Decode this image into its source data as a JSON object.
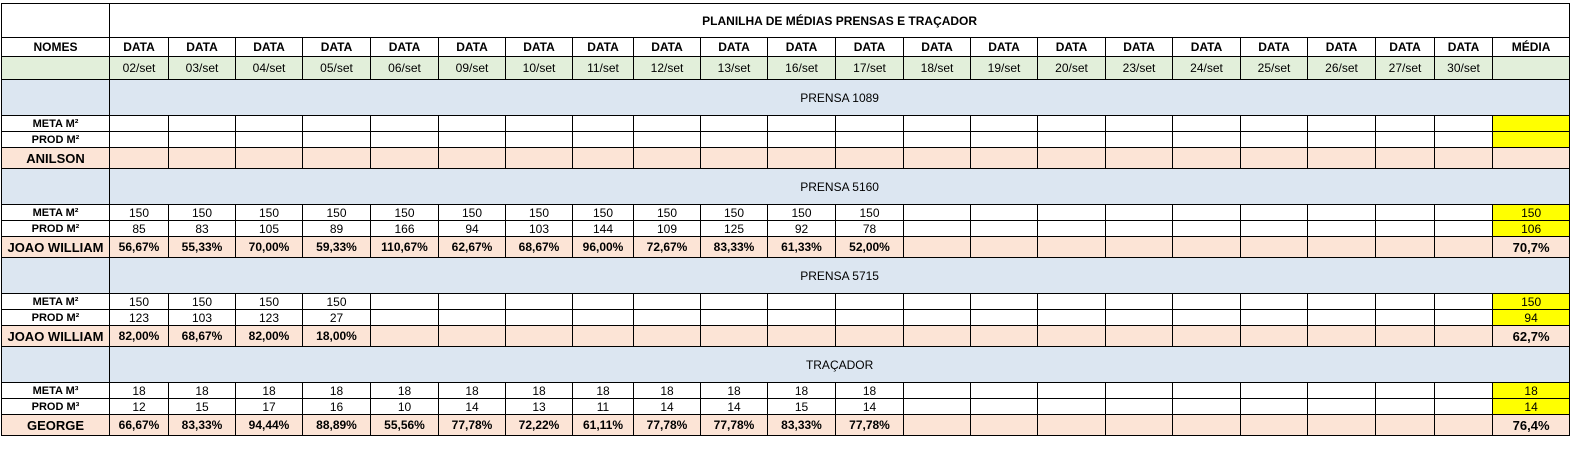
{
  "title": "PLANILHA DE MÉDIAS PRENSAS E TRAÇADOR",
  "header": {
    "names_label": "NOMES",
    "data_label": "DATA",
    "avg_label": "MÉDIA"
  },
  "dates": [
    "02/set",
    "03/set",
    "04/set",
    "05/set",
    "06/set",
    "09/set",
    "10/set",
    "11/set",
    "12/set",
    "13/set",
    "16/set",
    "17/set",
    "18/set",
    "19/set",
    "20/set",
    "23/set",
    "24/set",
    "25/set",
    "26/set",
    "27/set",
    "30/set"
  ],
  "sections": [
    {
      "title": "PRENSA 1089",
      "rows": [
        {
          "label": "META M²",
          "type": "meta",
          "values": [
            "",
            "",
            "",
            "",
            "",
            "",
            "",
            "",
            "",
            "",
            "",
            "",
            "",
            "",
            "",
            "",
            "",
            "",
            "",
            "",
            ""
          ],
          "avg": ""
        },
        {
          "label": "PROD M²",
          "type": "prod",
          "values": [
            "",
            "",
            "",
            "",
            "",
            "",
            "",
            "",
            "",
            "",
            "",
            "",
            "",
            "",
            "",
            "",
            "",
            "",
            "",
            "",
            ""
          ],
          "avg": ""
        },
        {
          "label": "ANILSON",
          "type": "pct",
          "values": [
            "",
            "",
            "",
            "",
            "",
            "",
            "",
            "",
            "",
            "",
            "",
            "",
            "",
            "",
            "",
            "",
            "",
            "",
            "",
            "",
            ""
          ],
          "avg": ""
        }
      ]
    },
    {
      "title": "PRENSA 5160",
      "rows": [
        {
          "label": "META M²",
          "type": "meta",
          "values": [
            "150",
            "150",
            "150",
            "150",
            "150",
            "150",
            "150",
            "150",
            "150",
            "150",
            "150",
            "150",
            "",
            "",
            "",
            "",
            "",
            "",
            "",
            "",
            ""
          ],
          "avg": "150"
        },
        {
          "label": "PROD M²",
          "type": "prod",
          "values": [
            "85",
            "83",
            "105",
            "89",
            "166",
            "94",
            "103",
            "144",
            "109",
            "125",
            "92",
            "78",
            "",
            "",
            "",
            "",
            "",
            "",
            "",
            "",
            ""
          ],
          "avg": "106"
        },
        {
          "label": "JOAO WILLIAM",
          "type": "pct",
          "values": [
            "56,67%",
            "55,33%",
            "70,00%",
            "59,33%",
            "110,67%",
            "62,67%",
            "68,67%",
            "96,00%",
            "72,67%",
            "83,33%",
            "61,33%",
            "52,00%",
            "",
            "",
            "",
            "",
            "",
            "",
            "",
            "",
            ""
          ],
          "avg": "70,7%"
        }
      ]
    },
    {
      "title": "PRENSA 5715",
      "rows": [
        {
          "label": "META M²",
          "type": "meta",
          "values": [
            "150",
            "150",
            "150",
            "150",
            "",
            "",
            "",
            "",
            "",
            "",
            "",
            "",
            "",
            "",
            "",
            "",
            "",
            "",
            "",
            "",
            ""
          ],
          "avg": "150"
        },
        {
          "label": "PROD M²",
          "type": "prod",
          "values": [
            "123",
            "103",
            "123",
            "27",
            "",
            "",
            "",
            "",
            "",
            "",
            "",
            "",
            "",
            "",
            "",
            "",
            "",
            "",
            "",
            "",
            ""
          ],
          "avg": "94"
        },
        {
          "label": "JOAO WILLIAM",
          "type": "pct",
          "values": [
            "82,00%",
            "68,67%",
            "82,00%",
            "18,00%",
            "",
            "",
            "",
            "",
            "",
            "",
            "",
            "",
            "",
            "",
            "",
            "",
            "",
            "",
            "",
            "",
            ""
          ],
          "avg": "62,7%"
        }
      ]
    },
    {
      "title": "TRAÇADOR",
      "rows": [
        {
          "label": "META M³",
          "type": "meta",
          "values": [
            "18",
            "18",
            "18",
            "18",
            "18",
            "18",
            "18",
            "18",
            "18",
            "18",
            "18",
            "18",
            "",
            "",
            "",
            "",
            "",
            "",
            "",
            "",
            ""
          ],
          "avg": "18"
        },
        {
          "label": "PROD M³",
          "type": "prod",
          "values": [
            "12",
            "15",
            "17",
            "16",
            "10",
            "14",
            "13",
            "11",
            "14",
            "14",
            "15",
            "14",
            "",
            "",
            "",
            "",
            "",
            "",
            "",
            "",
            ""
          ],
          "avg": "14"
        },
        {
          "label": "GEORGE",
          "type": "pct",
          "values": [
            "66,67%",
            "83,33%",
            "94,44%",
            "88,89%",
            "55,56%",
            "77,78%",
            "72,22%",
            "61,11%",
            "77,78%",
            "77,78%",
            "83,33%",
            "77,78%",
            "",
            "",
            "",
            "",
            "",
            "",
            "",
            "",
            ""
          ],
          "avg": "76,4%"
        }
      ]
    }
  ],
  "colors": {
    "date_row_bg": "#e2efda",
    "section_bg": "#dce6f1",
    "pct_row_bg": "#fce4d6",
    "avg_highlight": "#ffff00"
  }
}
